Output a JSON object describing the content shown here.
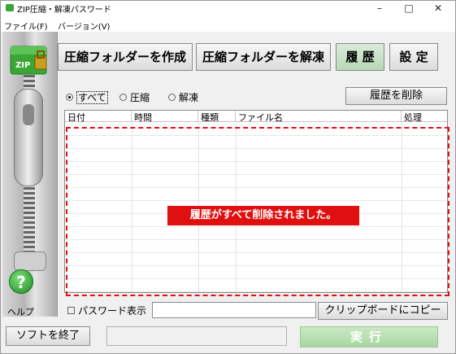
{
  "window": {
    "title": "ZIP圧縮・解凍パスワード",
    "minimize": "–",
    "maximize": "□",
    "close": "✕"
  },
  "menu": {
    "items": [
      "ファイル(F)",
      "バージョン(V)"
    ]
  },
  "toolbar": {
    "create_label": "圧縮フォルダーを作成",
    "extract_label": "圧縮フォルダーを解凍",
    "history_label": "履 歴",
    "settings_label": "設 定",
    "icon_text": "ZIP"
  },
  "filter": {
    "options": [
      "すべて",
      "圧縮",
      "解凍"
    ],
    "selected": "すべて"
  },
  "delete_history_label": "履歴を削除",
  "table": {
    "columns": [
      "日付",
      "時間",
      "種類",
      "ファイル名",
      "処理"
    ]
  },
  "message": "履歴がすべて削除されました。",
  "help": {
    "icon_text": "?",
    "label": "ヘルプ"
  },
  "password": {
    "checkbox_label": "パスワード表示",
    "value": ""
  },
  "clipboard_label": "クリップボードにコピー",
  "exit_label": "ソフトを終了",
  "run_label": "実行",
  "colors": {
    "accent_red": "#e01010",
    "run_green": "#a9d6a2",
    "help_green": "#1f8a1f"
  }
}
